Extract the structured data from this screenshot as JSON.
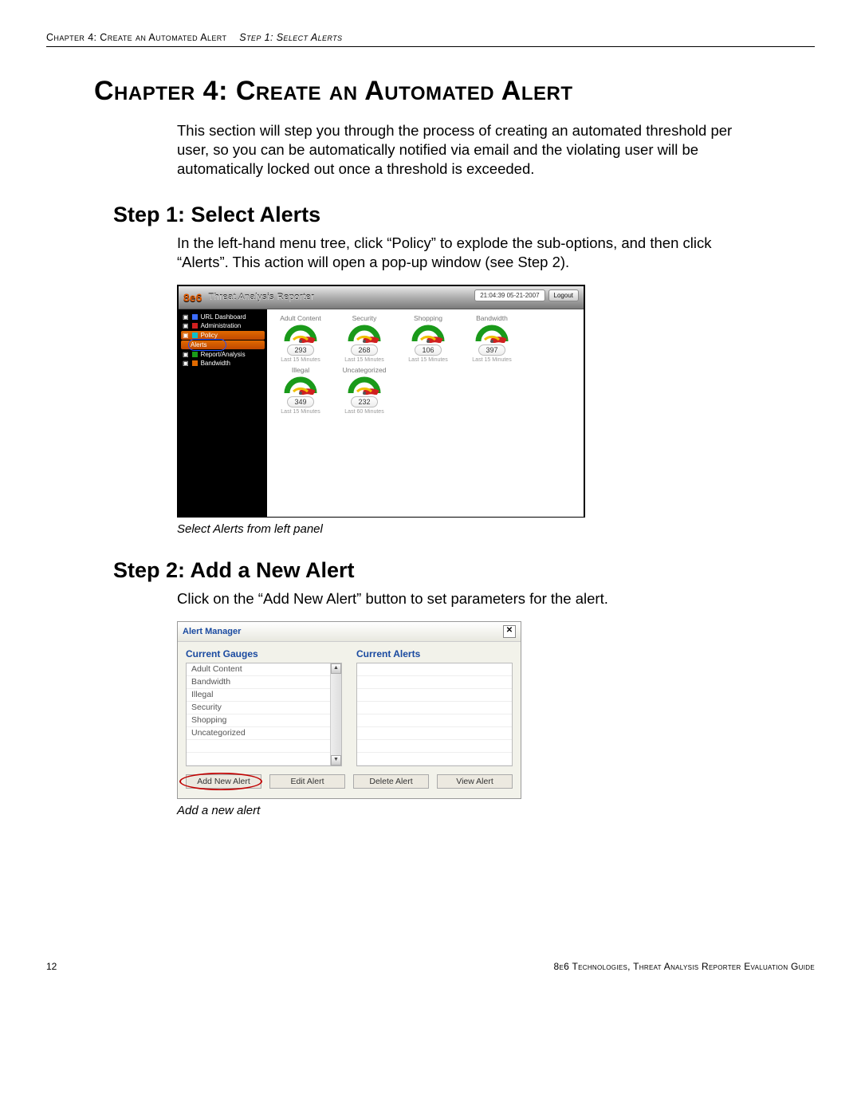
{
  "running_head": {
    "chapter": "Chapter 4: Create an Automated Alert",
    "step": "Step 1: Select Alerts"
  },
  "chapter_title": "Chapter 4: Create an Automated Alert",
  "intro": "This section will step you through the process of creating an automated threshold per user, so you can be automatically notified via email and the violating user will be automatically locked out once a threshold is exceeded.",
  "step1": {
    "title": "Step 1: Select Alerts",
    "para": "In the left-hand menu tree, click “Policy” to explode the sub-options, and then click “Alerts”. This action will open a pop-up window (see Step 2).",
    "caption": "Select Alerts from left panel"
  },
  "tar": {
    "brand": "8e6",
    "title": "Threat Analysis Reporter",
    "timestamp": "21:04:39 05-21-2007",
    "logout": "Logout",
    "nav": {
      "url_dashboard": "URL Dashboard",
      "administration": "Administration",
      "policy": "Policy",
      "alerts": "Alerts",
      "report_analysis": "Report/Analysis",
      "bandwidth": "Bandwidth"
    },
    "gauges": [
      {
        "title": "Adult Content",
        "value": "293",
        "sub": "Last 15 Minutes"
      },
      {
        "title": "Security",
        "value": "268",
        "sub": "Last 15 Minutes"
      },
      {
        "title": "Shopping",
        "value": "106",
        "sub": "Last 15 Minutes"
      },
      {
        "title": "Bandwidth",
        "value": "397",
        "sub": "Last 15 Minutes"
      },
      {
        "title": "Illegal",
        "value": "349",
        "sub": "Last 15 Minutes"
      },
      {
        "title": "Uncategorized",
        "value": "232",
        "sub": "Last 60 Minutes"
      }
    ]
  },
  "step2": {
    "title": "Step 2: Add a New Alert",
    "para": "Click on the “Add New Alert” button to set parameters for the alert.",
    "caption": "Add a new alert"
  },
  "am": {
    "title": "Alert Manager",
    "gauges_label": "Current Gauges",
    "alerts_label": "Current Alerts",
    "gauges": [
      "Adult Content",
      "Bandwidth",
      "Illegal",
      "Security",
      "Shopping",
      "Uncategorized"
    ],
    "buttons": {
      "add": "Add New Alert",
      "edit": "Edit Alert",
      "delete": "Delete Alert",
      "view": "View Alert"
    }
  },
  "footer": {
    "page": "12",
    "right": "8e6 Technologies, Threat Analysis Reporter Evaluation Guide"
  }
}
